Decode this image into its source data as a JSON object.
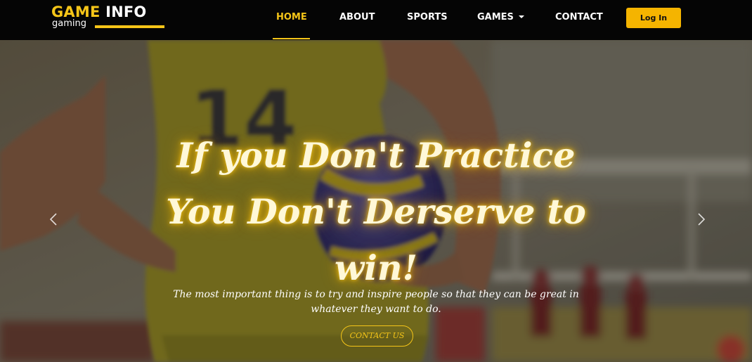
{
  "brand": {
    "name_part1": "GAME",
    "name_part2": "INFO",
    "tagline": "gaming",
    "accent_color": "#f5c518"
  },
  "nav": {
    "items": [
      {
        "label": "HOME",
        "active": true
      },
      {
        "label": "ABOUT",
        "active": false
      },
      {
        "label": "SPORTS",
        "active": false
      },
      {
        "label": "GAMES",
        "active": false,
        "dropdown": true
      },
      {
        "label": "CONTACT",
        "active": false
      }
    ],
    "login_label": "Log In"
  },
  "hero": {
    "headline_line1": "If you Don't Practice",
    "headline_line2": "You Don't Derserve to",
    "headline_line3": "win!",
    "subtext": "The most important thing is to try and inspire people so that they can be great in whatever they want to do.",
    "button_label": "CONTACT US",
    "jersey_number": "14",
    "prev_icon": "chevron-left-icon",
    "next_icon": "chevron-right-icon"
  }
}
